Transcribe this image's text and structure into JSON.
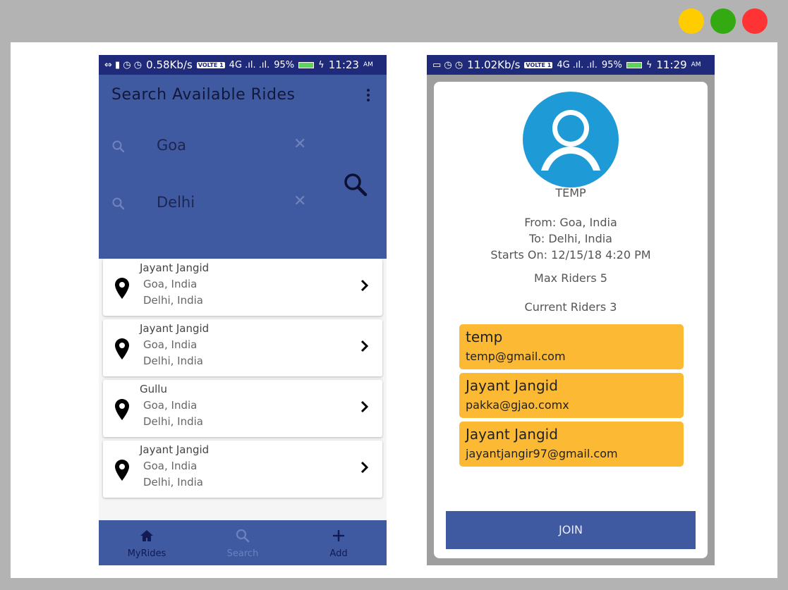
{
  "colors": {
    "status_bar": "#1f2a7a",
    "primary": "#3f5aa0",
    "rider_card": "#fbb934",
    "avatar": "#1e9bd7"
  },
  "status_left": {
    "rate": "0.58Kb/s",
    "volte": "VOLTE 1",
    "signal": "4G .ıl. .ıl.",
    "battery": "95%",
    "time": "11:23",
    "ampm": "AM"
  },
  "status_right": {
    "rate": "11.02Kb/s",
    "volte": "VOLTE 1",
    "signal": "4G .ıl. .ıl.",
    "battery": "95%",
    "time": "11:29",
    "ampm": "AM"
  },
  "search_screen": {
    "title": "Search Available Rides",
    "from_value": "Goa",
    "to_value": "Delhi",
    "clear_glyph": "✕",
    "rides": [
      {
        "name": "Jayant Jangid",
        "from": "Goa, India",
        "to": "Delhi, India"
      },
      {
        "name": "Jayant Jangid",
        "from": "Goa, India",
        "to": "Delhi, India"
      },
      {
        "name": "Gullu",
        "from": "Goa, India",
        "to": "Delhi, India"
      },
      {
        "name": "Jayant Jangid",
        "from": "Goa, India",
        "to": "Delhi, India"
      }
    ],
    "nav": {
      "myrides": "MyRides",
      "search": "Search",
      "add": "Add"
    }
  },
  "detail_screen": {
    "user_name": "TEMP",
    "from": "From: Goa, India",
    "to": "To: Delhi, India",
    "starts_on": "Starts On: 12/15/18 4:20 PM",
    "max_riders": "Max Riders  5",
    "current_riders": "Current Riders  3",
    "riders": [
      {
        "name": "temp",
        "email": "temp@gmail.com"
      },
      {
        "name": "Jayant Jangid",
        "email": "pakka@gjao.comx"
      },
      {
        "name": "Jayant Jangid",
        "email": "jayantjangir97@gmail.com"
      }
    ],
    "join_label": "JOIN"
  },
  "icons": {
    "menu": "more-vert-icon",
    "search": "search-icon",
    "clear": "close-icon",
    "pin": "location-pin-icon",
    "chevron": "chevron-right-icon",
    "home": "home-icon",
    "add": "plus-icon",
    "avatar": "user-avatar-icon"
  }
}
